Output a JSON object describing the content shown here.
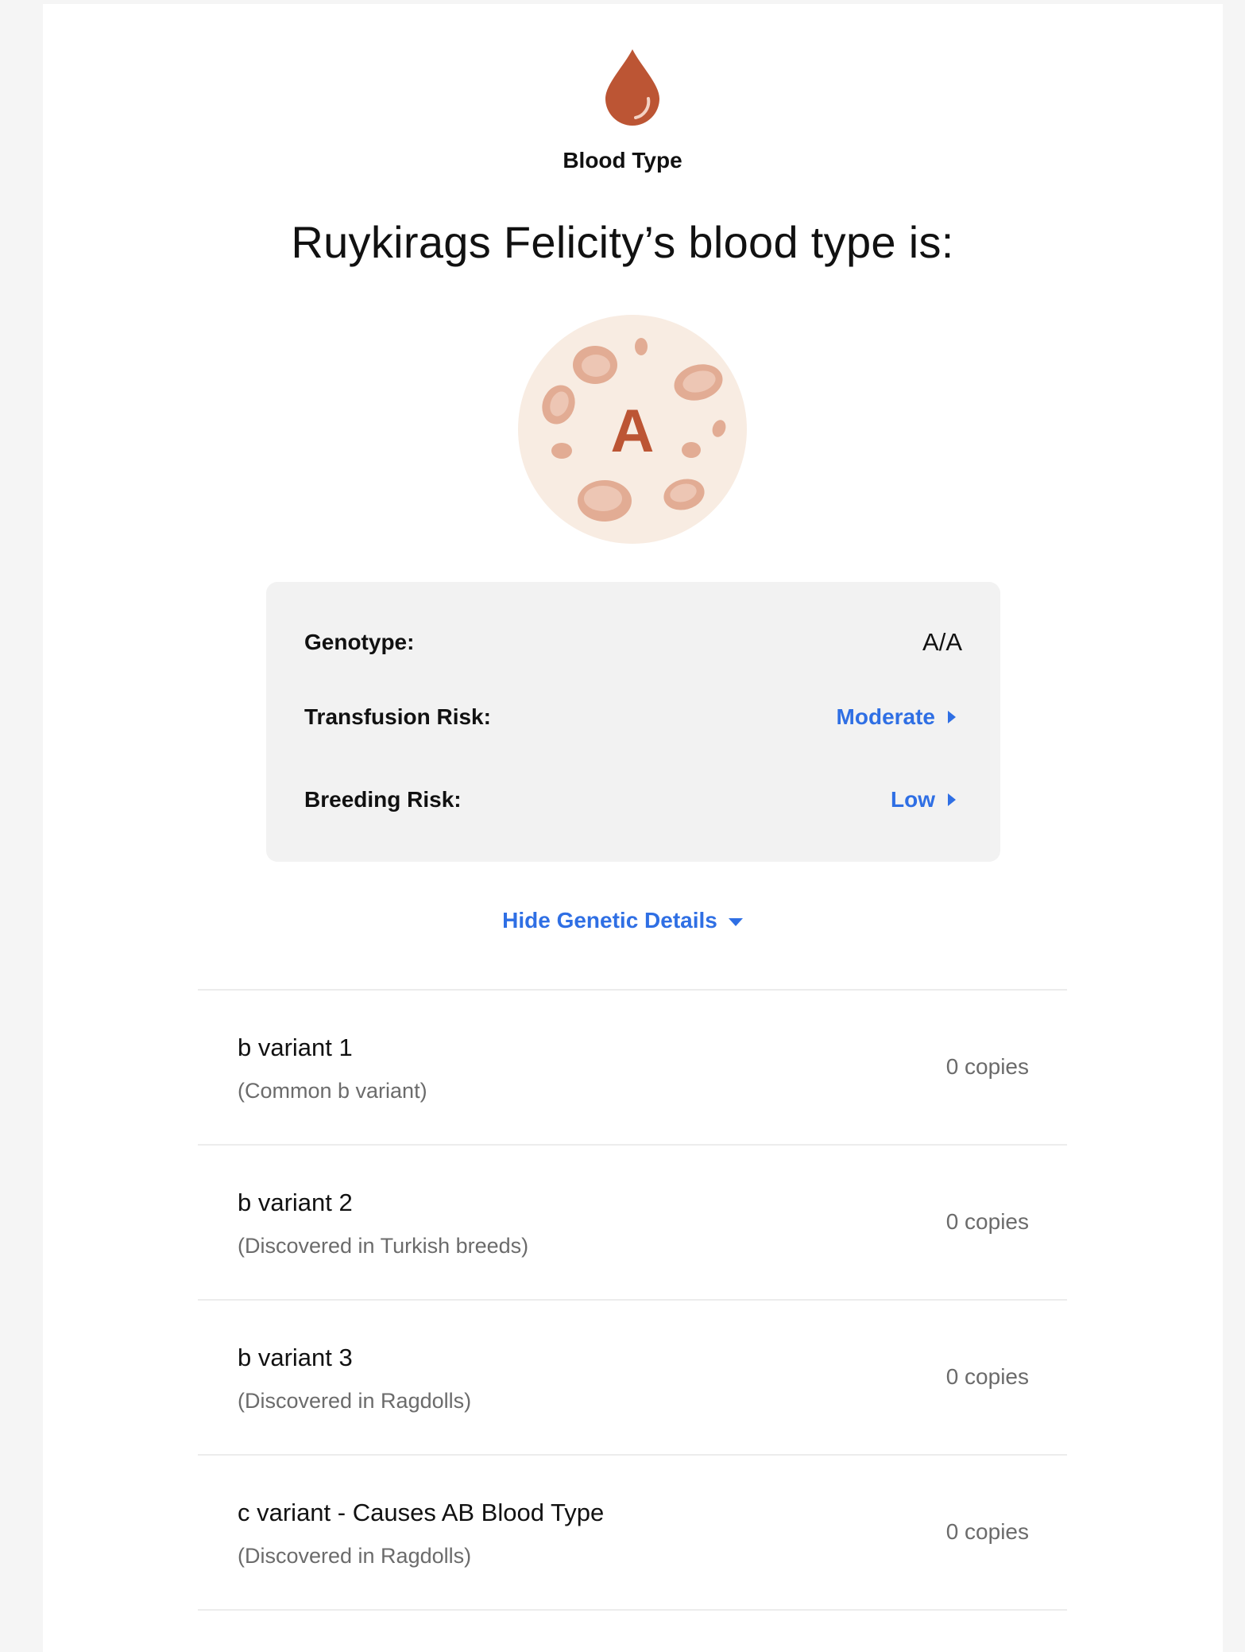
{
  "colors": {
    "accent_blue": "#2f6fe4",
    "blood_red": "#bc5534",
    "circle_fill": "#f8ece2",
    "cell_fill": "#e2ac94",
    "panel_bg": "#f2f2f2"
  },
  "header": {
    "icon": "blood-drop-icon",
    "section_label": "Blood Type",
    "headline": "Ruykirags Felicity’s blood type is:"
  },
  "blood_type": {
    "icon": "blood-cells-illustration",
    "letter": "A"
  },
  "summary": {
    "genotype": {
      "label": "Genotype:",
      "value": "A/A"
    },
    "transfusion_risk": {
      "label": "Transfusion Risk:",
      "value": "Moderate",
      "icon": "caret-right-icon"
    },
    "breeding_risk": {
      "label": "Breeding Risk:",
      "value": "Low",
      "icon": "caret-right-icon"
    }
  },
  "details_toggle": {
    "label": "Hide Genetic Details",
    "icon": "caret-down-icon"
  },
  "variants": [
    {
      "name": "b variant 1",
      "description": "(Common b variant)",
      "copies": "0 copies"
    },
    {
      "name": "b variant 2",
      "description": "(Discovered in Turkish breeds)",
      "copies": "0 copies"
    },
    {
      "name": "b variant 3",
      "description": "(Discovered in Ragdolls)",
      "copies": "0 copies"
    },
    {
      "name": "c variant - Causes AB Blood Type",
      "description": "(Discovered in Ragdolls)",
      "copies": "0 copies"
    }
  ]
}
